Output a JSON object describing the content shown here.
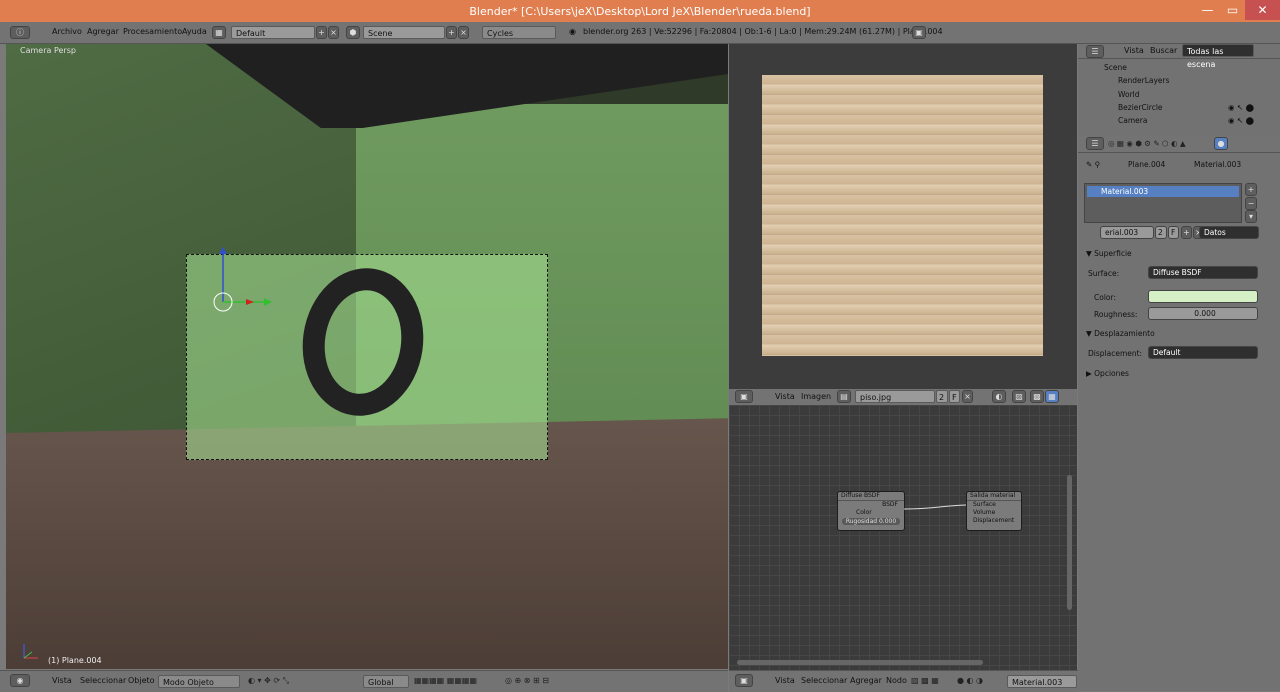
{
  "window": {
    "title": "Blender* [C:\\Users\\jeX\\Desktop\\Lord JeX\\Blender\\rueda.blend]"
  },
  "topbar": {
    "menu": [
      "Archivo",
      "Agregar",
      "Procesamiento",
      "Ayuda"
    ],
    "layout": "Default",
    "scene": "Scene",
    "engine": "Cycles",
    "stats": "blender.org 263 | Ve:52296 | Fa:20804 | Ob:1-6 | La:0 | Mem:29.24M (61.27M) | Plane.004"
  },
  "viewport": {
    "label": "Camera Persp",
    "object": "(1) Plane.004"
  },
  "viewport_header": {
    "vista": "Vista",
    "seleccion": "Seleccionar",
    "objeto": "Objeto",
    "mode": "Modo Objeto",
    "orientation": "Global"
  },
  "image_editor": {
    "vista": "Vista",
    "imagen": "Imagen",
    "image_name": "piso.jpg",
    "users": "2",
    "fake": "F"
  },
  "nodes": {
    "diffuse": {
      "title": "Diffuse BSDF",
      "out": "BSDF",
      "color": "Color",
      "rough": "Rugosidad 0.000"
    },
    "output": {
      "title": "Salida material",
      "surface": "Surface",
      "volume": "Volume",
      "disp": "Displacement"
    }
  },
  "node_header": {
    "vista": "Vista",
    "seleccion": "Seleccionar",
    "agregar": "Agregar",
    "nodo": "Nodo",
    "material": "Material.003"
  },
  "outliner": {
    "vista": "Vista",
    "buscar": "Buscar",
    "filter": "Todas las escena",
    "items": [
      "Scene",
      "RenderLayers",
      "World",
      "BezierCircle",
      "Camera"
    ]
  },
  "properties": {
    "path": [
      "Plane.004",
      "Material.003"
    ],
    "material_slot": "Material.003",
    "mat_field": "erial.003",
    "users": "2",
    "fake": "F",
    "link": "Datos",
    "surface_section": "Superficie",
    "surface_label": "Surface:",
    "surface_value": "Diffuse BSDF",
    "color_label": "Color:",
    "rough_label": "Roughness:",
    "rough_value": "0.000",
    "disp_section": "Desplazamiento",
    "disp_label": "Displacement:",
    "disp_value": "Default",
    "options_section": "Opciones"
  },
  "colors": {
    "title": "#e07e4f",
    "surface_color": "#d5f0c4",
    "selected": "#5680c2"
  }
}
